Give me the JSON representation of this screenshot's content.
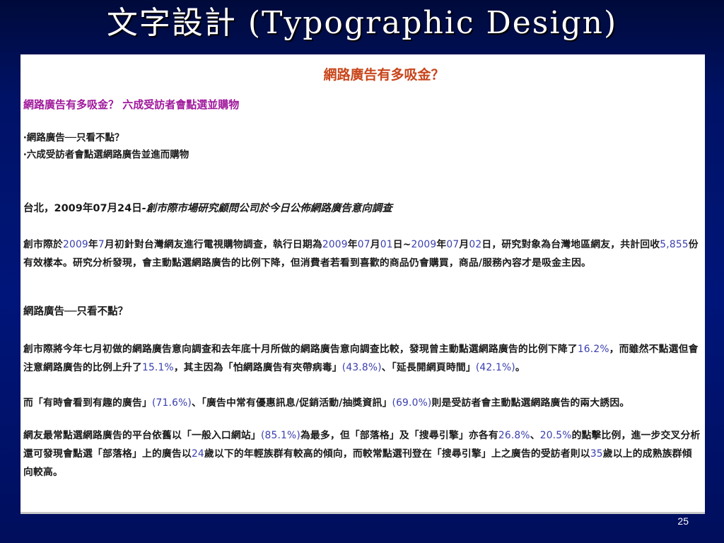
{
  "slide": {
    "title": "文字設計 (Typographic Design)",
    "page_number": "25"
  },
  "article": {
    "heading": "網路廣告有多吸金？",
    "headline": "網路廣告有多吸金？ 六成受訪者會點選並購物",
    "bullets": [
      "‧網路廣告──只看不點？",
      "‧六成受訪者會點選網路廣告並進而購物"
    ],
    "dateline": {
      "place": "台北，",
      "date": "2009年07月24日",
      "source": "-創市際市場研究顧問公司於今日公佈網路廣告意向調查"
    },
    "para1": {
      "t1": "創市際於",
      "n1": "2009",
      "t2": "年",
      "n2": "7",
      "t3": "月初針對台灣網友進行電視購物調查，執行日期為",
      "n3": "2009",
      "t4": "年",
      "n4": "07",
      "t5": "月",
      "n5": "01",
      "t6": "日~",
      "n6": "2009",
      "t7": "年",
      "n7": "07",
      "t8": "月",
      "n8": "02",
      "t9": "日，研究對象為台灣地區網友，共計回收",
      "n9": "5,855",
      "t10": "份有效樣本。研究分析發現，會主動點選網路廣告的比例下降，但消費者若看到喜歡的商品仍會購買，商品/服務內容才是吸金主因。"
    },
    "section_title": "網路廣告──只看不點？",
    "para2": {
      "t1": "創市際將今年七月初做的網路廣告意向調查和去年底十月所做的網路廣告意向調查比較，發現曾主動點選網路廣告的比例下降了",
      "n1": "16.2%",
      "t2": "，而雖然不點選但會注意網路廣告的比例上升了",
      "n2": "15.1%",
      "t3": "，其主因為「怕網路廣告有夾帶病毒」",
      "n3": "(43.8%)",
      "t4": "、「延長開網頁時間」",
      "n4": "(42.1%)",
      "t5": "。"
    },
    "para3": {
      "t1": "而「有時會看到有趣的廣告」",
      "n1": "(71.6%)",
      "t2": "、「廣告中常有優惠訊息/促銷活動/抽獎資訊」",
      "n2": "(69.0%)",
      "t3": "則是受訪者會主動點選網路廣告的兩大誘因。"
    },
    "para4": {
      "t1": "網友最常點選網路廣告的平台依舊以「一般入口網站」",
      "n1": "(85.1%)",
      "t2": "為最多，但「部落格」及「搜尋引擎」亦各有",
      "n2": "26.8%",
      "t3": "、",
      "n3": "20.5%",
      "t4": "的點擊比例，進一步交叉分析還可發現會點選「部落格」上的廣告以",
      "n4": "24",
      "t5": "歲以下的年輕族群有較高的傾向，而較常點選刊登在「搜尋引擎」上之廣告的受訪者則以",
      "n5": "35",
      "t6": "歲以上的成熟族群傾向較高。"
    }
  }
}
